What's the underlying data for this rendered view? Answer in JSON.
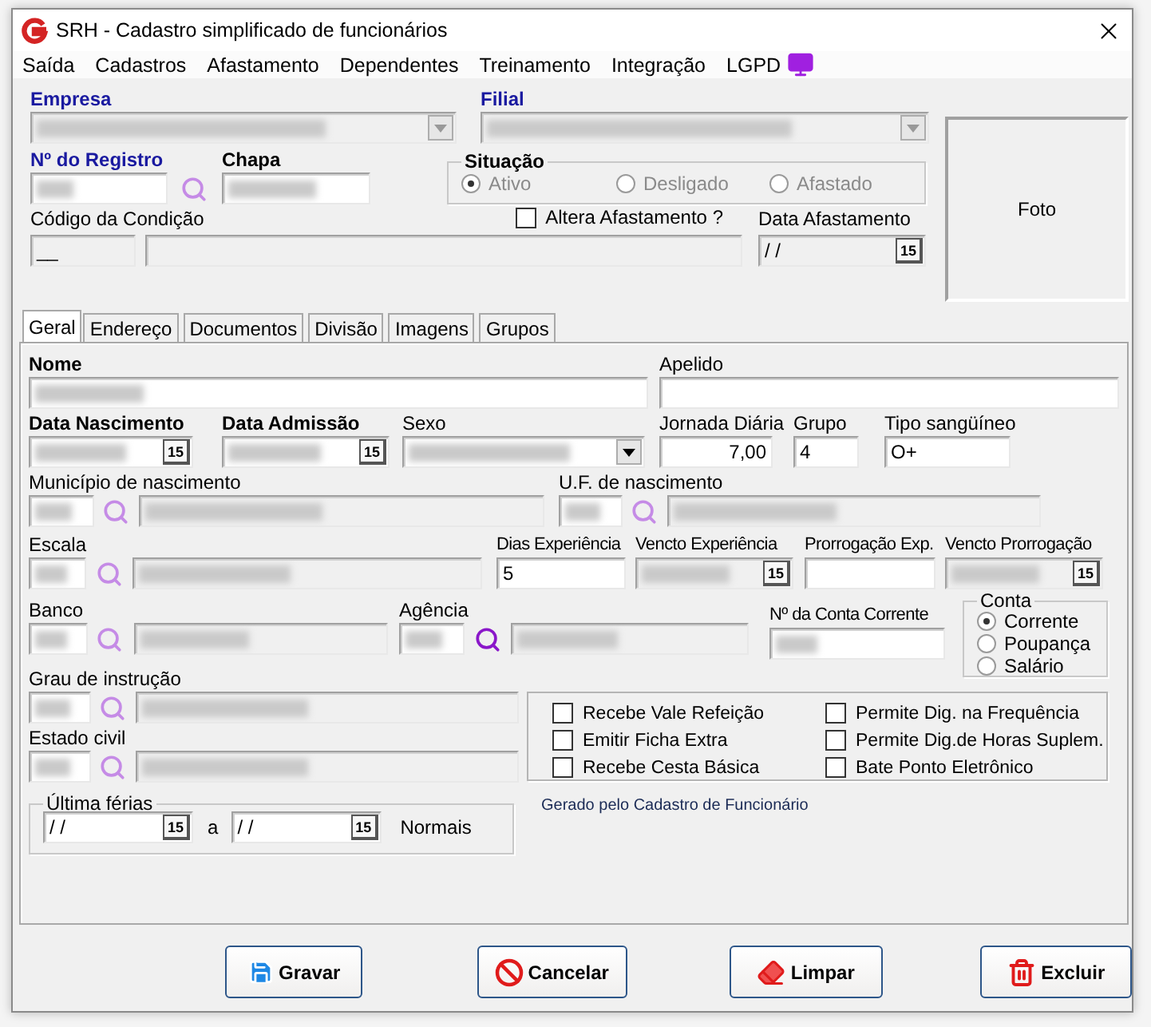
{
  "window": {
    "title": "SRH - Cadastro simplificado de funcionários"
  },
  "menu": [
    "Saída",
    "Cadastros",
    "Afastamento",
    "Dependentes",
    "Treinamento",
    "Integração",
    "LGPD"
  ],
  "header": {
    "empresa": {
      "label": "Empresa",
      "redacted": true
    },
    "filial": {
      "label": "Filial",
      "redacted": true
    },
    "registro": {
      "label": "Nº do Registro",
      "redacted": true
    },
    "chapa": {
      "label": "Chapa",
      "redacted": true
    },
    "situacao": {
      "label": "Situação",
      "disabled": true,
      "options": [
        {
          "label": "Ativo",
          "selected": true
        },
        {
          "label": "Desligado",
          "selected": false
        },
        {
          "label": "Afastado",
          "selected": false
        }
      ]
    },
    "altera_afastamento": {
      "label": "Altera Afastamento ?",
      "checked": false
    },
    "codigo_condicao": {
      "label": "Código da Condição",
      "value": "__"
    },
    "data_afastamento": {
      "label": "Data Afastamento",
      "value": "/ /",
      "button": "15"
    },
    "foto": {
      "label": "Foto"
    }
  },
  "tabs": [
    {
      "label": "Geral",
      "selected": true
    },
    {
      "label": "Endereço",
      "selected": false
    },
    {
      "label": "Documentos",
      "selected": false
    },
    {
      "label": "Divisão",
      "selected": false
    },
    {
      "label": "Imagens",
      "selected": false
    },
    {
      "label": "Grupos",
      "selected": false
    }
  ],
  "geral": {
    "nome": {
      "label": "Nome",
      "redacted": true
    },
    "apelido": {
      "label": "Apelido"
    },
    "data_nascimento": {
      "label": "Data Nascimento",
      "redacted": true,
      "button": "15"
    },
    "data_admissao": {
      "label": "Data Admissão",
      "redacted": true,
      "button": "15"
    },
    "sexo": {
      "label": "Sexo",
      "redacted": true
    },
    "jornada": {
      "label": "Jornada Diária",
      "value": "7,00"
    },
    "grupo": {
      "label": "Grupo",
      "value": "4"
    },
    "tipo_sanguineo": {
      "label": "Tipo sangüíneo",
      "value": "O+"
    },
    "municipio": {
      "label": "Município de nascimento",
      "redacted": true
    },
    "uf": {
      "label": "U.F. de nascimento",
      "redacted": true
    },
    "escala": {
      "label": "Escala",
      "redacted": true
    },
    "dias_experiencia": {
      "label": "Dias Experiência",
      "value": "5"
    },
    "vencto_experiencia": {
      "label": "Vencto Experiência",
      "redacted": true,
      "button": "15"
    },
    "prorrogacao": {
      "label": "Prorrogação Exp."
    },
    "vencto_prorrogacao": {
      "label": "Vencto Prorrogação",
      "redacted": true,
      "button": "15"
    },
    "banco": {
      "label": "Banco",
      "redacted": true
    },
    "agencia": {
      "label": "Agência",
      "redacted": true
    },
    "conta_corrente": {
      "label": "Nº da Conta Corrente",
      "redacted": true
    },
    "conta": {
      "label": "Conta",
      "options": [
        {
          "label": "Corrente",
          "selected": true
        },
        {
          "label": "Poupança",
          "selected": false
        },
        {
          "label": "Salário",
          "selected": false
        }
      ]
    },
    "grau_instrucao": {
      "label": "Grau de instrução",
      "redacted": true
    },
    "estado_civil": {
      "label": "Estado civil",
      "redacted": true
    },
    "flags": [
      {
        "label": "Recebe Vale Refeição",
        "checked": false
      },
      {
        "label": "Emitir Ficha Extra",
        "checked": false
      },
      {
        "label": "Recebe Cesta Básica",
        "checked": false
      },
      {
        "label": "Permite Dig. na Frequência",
        "checked": false
      },
      {
        "label": "Permite Dig.de Horas Suplem.",
        "checked": false
      },
      {
        "label": "Bate Ponto Eletrônico",
        "checked": false
      }
    ],
    "ultima_ferias": {
      "label": "Última férias",
      "from": {
        "value": "/ /",
        "button": "15"
      },
      "separator": "a",
      "to": {
        "value": "/ /",
        "button": "15"
      },
      "type": "Normais"
    },
    "note": "Gerado pelo Cadastro de Funcionário"
  },
  "buttons": [
    {
      "label": "Gravar",
      "kind": "save"
    },
    {
      "label": "Cancelar",
      "kind": "cancel"
    },
    {
      "label": "Limpar",
      "kind": "clear"
    },
    {
      "label": "Excluir",
      "kind": "delete"
    }
  ]
}
